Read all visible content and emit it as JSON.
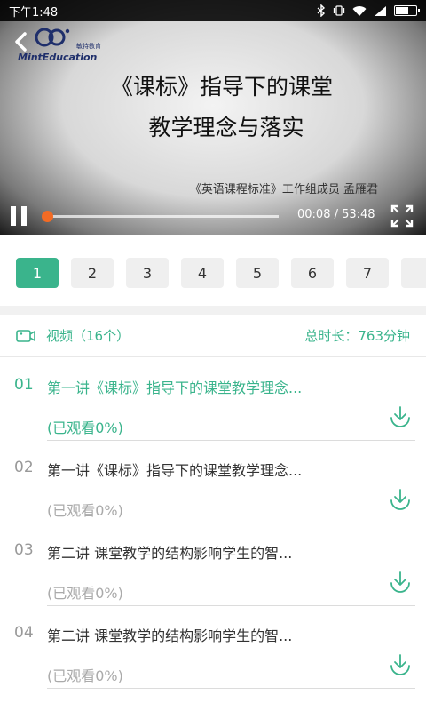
{
  "status_bar": {
    "time": "下午1:48"
  },
  "player": {
    "slide_title_line1": "《课标》指导下的课堂",
    "slide_title_line2": "教学理念与落实",
    "slide_author": "《英语课程标准》工作组成员  孟雁君",
    "logo_text": "MintEducation",
    "logo_cn": "敏特教育",
    "time_display": "00:08 / 53:48",
    "progress_fraction": 0.0025,
    "is_playing": true
  },
  "episode_tabs": {
    "items": [
      "1",
      "2",
      "3",
      "4",
      "5",
      "6",
      "7"
    ],
    "active_index": 0
  },
  "section": {
    "count_label": "视频（16个）",
    "duration_label": "总时长：763分钟"
  },
  "videos": [
    {
      "num": "01",
      "title": "第一讲《课标》指导下的课堂教学理念...",
      "watched": "(已观看0%)",
      "active": true
    },
    {
      "num": "02",
      "title": "第一讲《课标》指导下的课堂教学理念...",
      "watched": "(已观看0%)",
      "active": false
    },
    {
      "num": "03",
      "title": "第二讲 课堂教学的结构影响学生的智...",
      "watched": "(已观看0%)",
      "active": false
    },
    {
      "num": "04",
      "title": "第二讲 课堂教学的结构影响学生的智...",
      "watched": "(已观看0%)",
      "active": false
    }
  ],
  "colors": {
    "accent": "#3ab48c",
    "progress": "#f36b24"
  }
}
